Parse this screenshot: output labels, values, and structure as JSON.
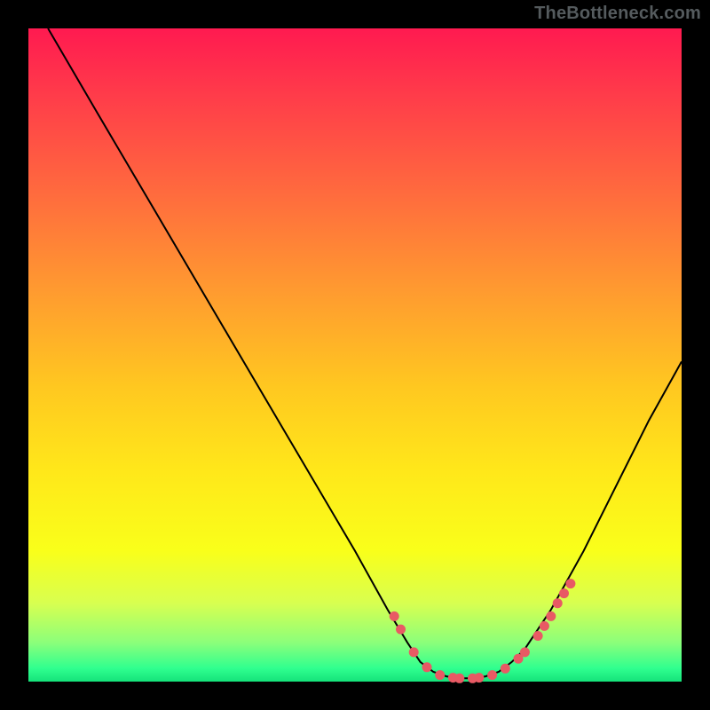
{
  "watermark": "TheBottleneck.com",
  "chart_data": {
    "type": "line",
    "title": "",
    "xlabel": "",
    "ylabel": "",
    "xlim": [
      0,
      100
    ],
    "ylim": [
      0,
      100
    ],
    "grid": false,
    "legend": null,
    "series": [
      {
        "name": "curve",
        "x": [
          3,
          10,
          20,
          30,
          40,
          50,
          55,
          58,
          60,
          62,
          64,
          66,
          68,
          70,
          72,
          74,
          76,
          80,
          85,
          90,
          95,
          100
        ],
        "y": [
          100,
          88,
          71,
          54,
          37,
          20,
          11,
          6,
          3,
          1.5,
          0.8,
          0.5,
          0.5,
          0.8,
          1.5,
          3,
          5,
          11,
          20,
          30,
          40,
          49
        ],
        "color": "#000000",
        "linewidth": 2
      },
      {
        "name": "dots",
        "x": [
          56,
          57,
          59,
          61,
          63,
          65,
          66,
          68,
          69,
          71,
          73,
          75,
          76,
          78,
          79,
          80,
          81,
          82,
          83
        ],
        "y": [
          10,
          8,
          4.5,
          2.2,
          1.0,
          0.6,
          0.5,
          0.5,
          0.6,
          1.0,
          2.0,
          3.5,
          4.5,
          7.0,
          8.5,
          10,
          12,
          13.5,
          15
        ],
        "color": "#e85a64",
        "marker_size": 11
      }
    ],
    "background_gradient_stops": [
      {
        "offset": 0.0,
        "color": "#ff1a50"
      },
      {
        "offset": 0.25,
        "color": "#ff6a3e"
      },
      {
        "offset": 0.55,
        "color": "#ffc820"
      },
      {
        "offset": 0.8,
        "color": "#f9ff1a"
      },
      {
        "offset": 0.94,
        "color": "#8cff7a"
      },
      {
        "offset": 1.0,
        "color": "#15e27a"
      }
    ]
  }
}
